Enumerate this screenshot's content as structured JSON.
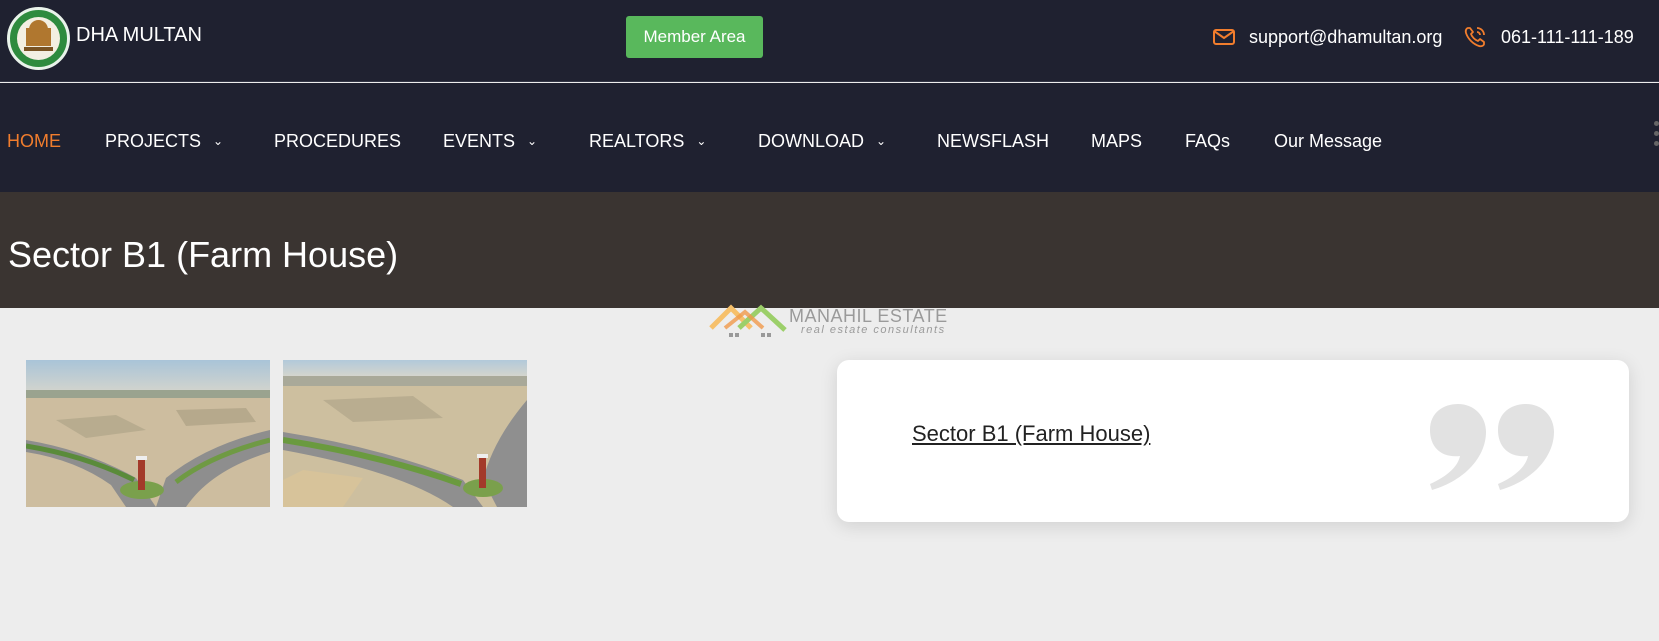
{
  "header": {
    "brand": "DHA MULTAN",
    "member_button": "Member Area",
    "email": "support@dhamultan.org",
    "phone": "061-111-111-189",
    "icons": {
      "email": "envelope-icon",
      "phone": "phone-icon"
    },
    "accent_color": "#f17d2d",
    "member_button_color": "#59b85c"
  },
  "nav": {
    "items": [
      {
        "label": "HOME",
        "active": true
      },
      {
        "label": "PROJECTS",
        "dropdown": true
      },
      {
        "label": "PROCEDURES"
      },
      {
        "label": "EVENTS",
        "dropdown": true
      },
      {
        "label": "REALTORS",
        "dropdown": true
      },
      {
        "label": "DOWNLOAD",
        "dropdown": true
      },
      {
        "label": "NEWSFLASH"
      },
      {
        "label": "MAPS"
      },
      {
        "label": "FAQs"
      },
      {
        "label": "Our Message"
      }
    ],
    "more_icon": "vertical-dots-icon"
  },
  "page": {
    "title": "Sector B1 (Farm House)"
  },
  "watermark": {
    "title": "MANAHIL ESTATE",
    "subtitle": "real estate consultants"
  },
  "gallery": {
    "images": [
      {
        "name": "aerial-photo-1"
      },
      {
        "name": "aerial-photo-2"
      }
    ]
  },
  "card": {
    "link_text": "Sector B1 (Farm House)",
    "icon": "quote-icon"
  }
}
